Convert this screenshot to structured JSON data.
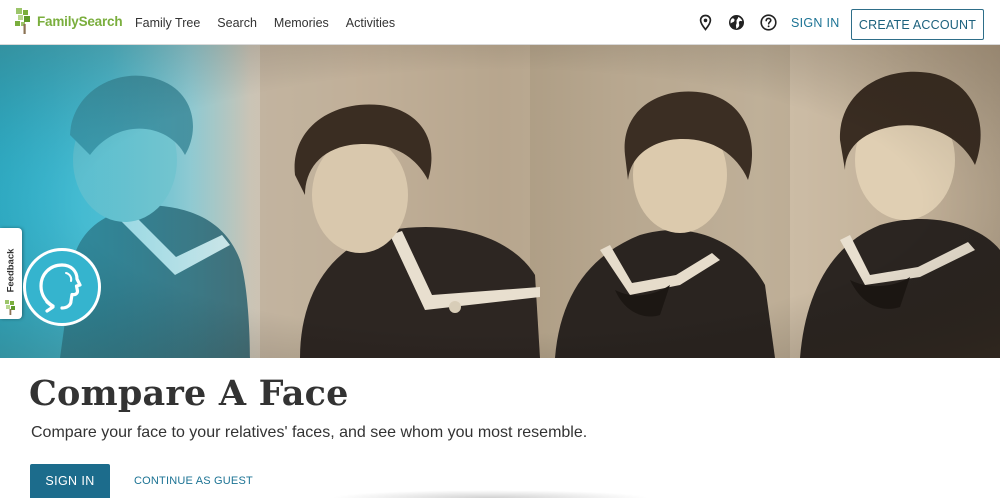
{
  "header": {
    "logo_text": "FamilySearch",
    "nav": [
      {
        "label": "Family Tree"
      },
      {
        "label": "Search"
      },
      {
        "label": "Memories"
      },
      {
        "label": "Activities"
      }
    ],
    "icons": [
      "location-pin-icon",
      "globe-icon",
      "help-icon"
    ],
    "sign_in_label": "SIGN IN",
    "create_account_label": "CREATE ACCOUNT"
  },
  "hero": {
    "feedback_label": "Feedback",
    "badge_icon": "compare-face-icon"
  },
  "main": {
    "title": "Compare A Face",
    "subtitle": "Compare your face to your relatives' faces, and see whom you most resemble.",
    "sign_in_button": "SIGN IN",
    "guest_link": "CONTINUE AS GUEST"
  },
  "colors": {
    "brand_green": "#7aae3d",
    "link_blue": "#1c7394",
    "button_blue": "#1c6c8c",
    "hero_teal": "#35b4ce"
  }
}
